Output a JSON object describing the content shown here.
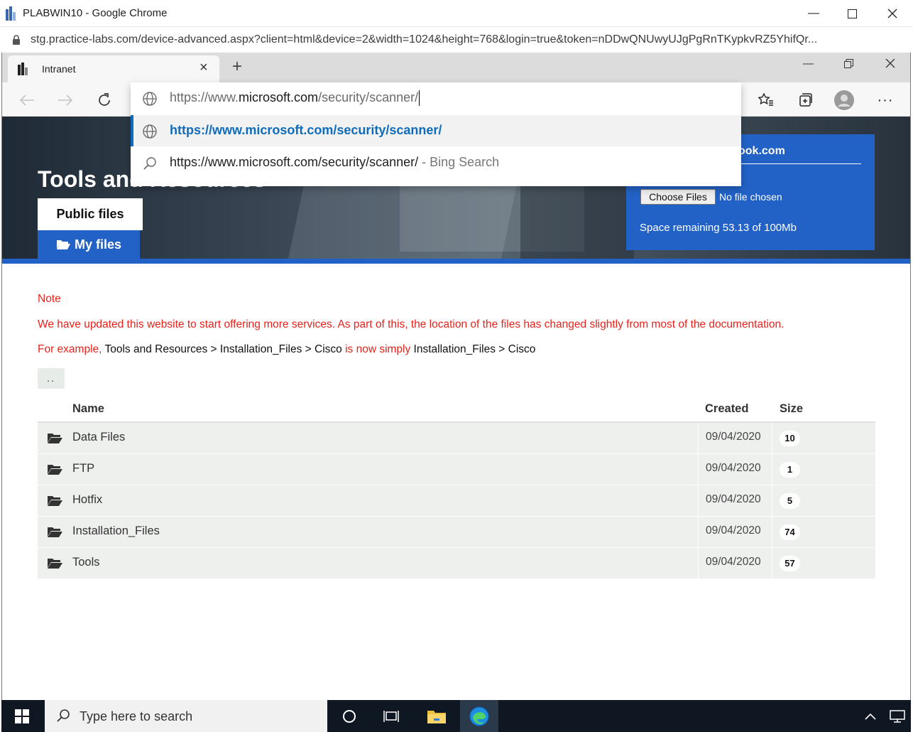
{
  "outer_window": {
    "title": "PLABWIN10 - Google Chrome",
    "url": "stg.practice-labs.com/device-advanced.aspx?client=html&device=2&width=1024&height=768&login=true&token=nDDwQNUwyUJgPgRnTKypkvRZ5YhifQr..."
  },
  "edge": {
    "tab_title": "Intranet",
    "omnibox": {
      "typed_host_prefix": "https://www.",
      "typed_host": "microsoft.com",
      "typed_path": "/security/scanner/",
      "suggestions": [
        {
          "text": "https://www.microsoft.com/security/scanner/",
          "suffix": ""
        },
        {
          "text": "https://www.microsoft.com/security/scanner/",
          "suffix": "- Bing Search"
        }
      ]
    }
  },
  "page": {
    "hero_title": "Tools and Resources",
    "public_tab": "Public files",
    "my_tab": "My files",
    "upload": {
      "account_fragment": "ook.com",
      "choose_button": "Choose Files",
      "no_file": "No file chosen",
      "space": "Space remaining 53.13 of 100Mb"
    },
    "note": {
      "heading": "Note",
      "line1": "We have updated this website to start offering more services. As part of this, the location of the files has changed slightly from most of the documentation.",
      "line2_prefix": "For example, ",
      "line2_old": "Tools and Resources > Installation_Files > Cisco",
      "line2_mid": " is now simply ",
      "line2_new": "Installation_Files > Cisco"
    },
    "updir": "..",
    "table": {
      "headers": {
        "name": "Name",
        "created": "Created",
        "size": "Size"
      },
      "rows": [
        {
          "name": "Data Files",
          "created": "09/04/2020",
          "size": "10"
        },
        {
          "name": "FTP",
          "created": "09/04/2020",
          "size": "1"
        },
        {
          "name": "Hotfix",
          "created": "09/04/2020",
          "size": "5"
        },
        {
          "name": "Installation_Files",
          "created": "09/04/2020",
          "size": "74"
        },
        {
          "name": "Tools",
          "created": "09/04/2020",
          "size": "57"
        }
      ]
    }
  },
  "taskbar": {
    "search_placeholder": "Type here to search"
  },
  "colors": {
    "brand_blue": "#2262c6",
    "note_red": "#e8221b",
    "edge_link_blue": "#0f6cbd"
  }
}
